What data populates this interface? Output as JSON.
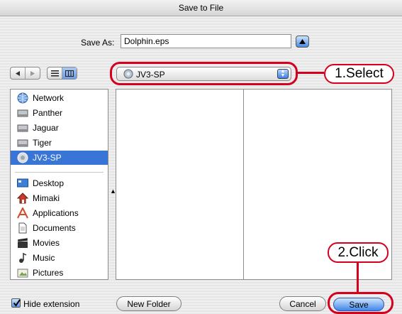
{
  "window": {
    "title": "Save to File"
  },
  "save_as": {
    "label": "Save As:",
    "value": "Dolphin.eps"
  },
  "location_popup": {
    "value": "JV3-SP"
  },
  "sidebar": {
    "volumes": [
      {
        "label": "Network",
        "icon": "network-icon"
      },
      {
        "label": "Panther",
        "icon": "hard-drive-icon"
      },
      {
        "label": "Jaguar",
        "icon": "hard-drive-icon"
      },
      {
        "label": "Tiger",
        "icon": "hard-drive-icon"
      },
      {
        "label": "JV3-SP",
        "icon": "printer-volume-icon",
        "selected": true
      }
    ],
    "places": [
      {
        "label": "Desktop",
        "icon": "desktop-icon"
      },
      {
        "label": "Mimaki",
        "icon": "home-icon"
      },
      {
        "label": "Applications",
        "icon": "applications-icon"
      },
      {
        "label": "Documents",
        "icon": "documents-icon"
      },
      {
        "label": "Movies",
        "icon": "movies-icon"
      },
      {
        "label": "Music",
        "icon": "music-icon"
      },
      {
        "label": "Pictures",
        "icon": "pictures-icon"
      }
    ]
  },
  "footer": {
    "hide_extension_label": "Hide extension",
    "hide_extension_checked": true,
    "new_folder_label": "New Folder",
    "cancel_label": "Cancel",
    "save_label": "Save"
  },
  "annotations": {
    "select_label": "1.Select",
    "click_label": "2.Click"
  },
  "colors": {
    "selection": "#3875d7",
    "callout": "#d4001e",
    "default_button": "#3f86ea"
  }
}
